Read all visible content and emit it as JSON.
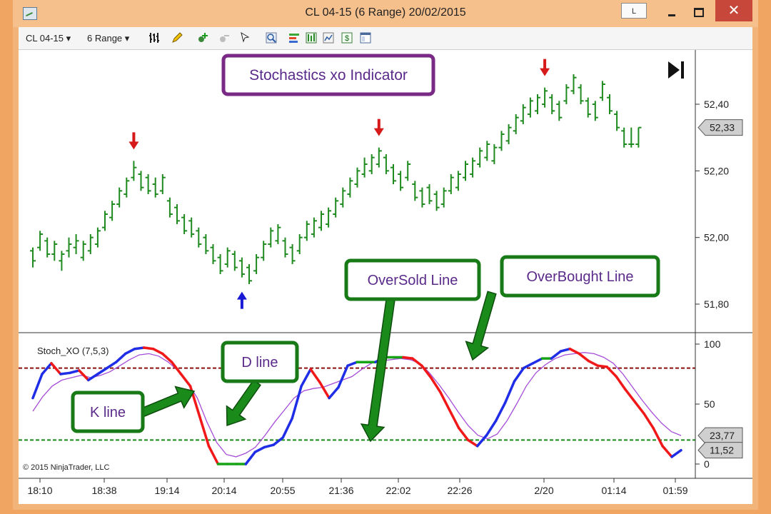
{
  "window": {
    "title": "CL 04-15 (6 Range)  20/02/2015",
    "l_button": "L",
    "close_glyph": "✕"
  },
  "toolbar": {
    "instrument": "CL 04-15",
    "interval": "6 Range",
    "icons": [
      "bar-style-icon",
      "pencil-icon",
      "add-indicator-icon",
      "remove-indicator-icon",
      "cursor-icon",
      "zoom-icon",
      "strategy-icon",
      "data-box-icon",
      "chart-icon",
      "dollar-icon",
      "properties-icon"
    ]
  },
  "colors": {
    "bars": "#1f8a1f",
    "k_up": "#1f2ee6",
    "k_down": "#f01818",
    "k_flat": "#17a317",
    "d_line": "#a64dd8",
    "overbought": "#8b1010",
    "oversold": "#178a17",
    "annotation_purple": "#7a2a86",
    "annotation_green": "#177a17"
  },
  "annotations": {
    "title": "Stochastics xo Indicator",
    "k_line": "K line",
    "d_line": "D line",
    "oversold": "OverSold Line",
    "overbought": "OverBought Line"
  },
  "chart_data": [
    {
      "type": "range-bar",
      "title": "CL 04-15 (6 Range)",
      "ylim": [
        51.74,
        52.52
      ],
      "y_ticks": [
        "52,40",
        "52,20",
        "52,00",
        "51,80"
      ],
      "y_tick_values": [
        52.4,
        52.2,
        52.0,
        51.8
      ],
      "last_price_label": "52,33",
      "last_price": 52.33,
      "bars": [
        [
          51.91,
          51.97,
          51.96,
          51.93
        ],
        [
          51.96,
          52.02,
          51.97,
          52.01
        ],
        [
          51.94,
          52.0,
          51.99,
          51.95
        ],
        [
          51.93,
          51.99,
          51.95,
          51.98
        ],
        [
          51.9,
          51.96,
          51.93,
          51.95
        ],
        [
          51.94,
          52.0,
          51.96,
          51.98
        ],
        [
          51.95,
          52.01,
          51.97,
          51.99
        ],
        [
          51.93,
          51.99,
          51.94,
          51.98
        ],
        [
          51.95,
          52.01,
          51.96,
          52.0
        ],
        [
          51.97,
          52.03,
          51.98,
          52.02
        ],
        [
          52.02,
          52.08,
          52.03,
          52.07
        ],
        [
          52.05,
          52.11,
          52.06,
          52.1
        ],
        [
          52.09,
          52.15,
          52.1,
          52.14
        ],
        [
          52.12,
          52.18,
          52.13,
          52.17
        ],
        [
          52.17,
          52.23,
          52.18,
          52.21
        ],
        [
          52.14,
          52.2,
          52.19,
          52.15
        ],
        [
          52.13,
          52.19,
          52.18,
          52.14
        ],
        [
          52.12,
          52.18,
          52.16,
          52.13
        ],
        [
          52.13,
          52.19,
          52.14,
          52.18
        ],
        [
          52.06,
          52.12,
          52.11,
          52.07
        ],
        [
          52.04,
          52.1,
          52.09,
          52.05
        ],
        [
          52.01,
          52.07,
          52.06,
          52.02
        ],
        [
          52.0,
          52.06,
          52.05,
          52.01
        ],
        [
          51.97,
          52.03,
          52.02,
          51.98
        ],
        [
          51.95,
          52.01,
          52.0,
          51.96
        ],
        [
          51.92,
          51.98,
          51.97,
          51.93
        ],
        [
          51.89,
          51.95,
          51.94,
          51.9
        ],
        [
          51.91,
          51.97,
          51.92,
          51.96
        ],
        [
          51.9,
          51.96,
          51.95,
          51.91
        ],
        [
          51.88,
          51.94,
          51.93,
          51.89
        ],
        [
          51.86,
          51.92,
          51.91,
          51.87
        ],
        [
          51.89,
          51.95,
          51.9,
          51.94
        ],
        [
          51.93,
          51.99,
          51.94,
          51.98
        ],
        [
          51.97,
          52.03,
          51.98,
          52.02
        ],
        [
          51.98,
          52.04,
          51.99,
          52.03
        ],
        [
          51.94,
          52.0,
          51.99,
          51.95
        ],
        [
          51.92,
          51.98,
          51.97,
          51.93
        ],
        [
          51.95,
          52.01,
          51.96,
          52.0
        ],
        [
          51.99,
          52.05,
          52.0,
          52.04
        ],
        [
          52.0,
          52.06,
          52.01,
          52.05
        ],
        [
          52.02,
          52.08,
          52.03,
          52.07
        ],
        [
          52.03,
          52.09,
          52.04,
          52.08
        ],
        [
          52.06,
          52.12,
          52.07,
          52.11
        ],
        [
          52.09,
          52.15,
          52.1,
          52.14
        ],
        [
          52.12,
          52.18,
          52.13,
          52.17
        ],
        [
          52.15,
          52.21,
          52.16,
          52.2
        ],
        [
          52.18,
          52.24,
          52.19,
          52.22
        ],
        [
          52.19,
          52.25,
          52.2,
          52.24
        ],
        [
          52.21,
          52.27,
          52.22,
          52.26
        ],
        [
          52.19,
          52.25,
          52.24,
          52.2
        ],
        [
          52.16,
          52.22,
          52.21,
          52.17
        ],
        [
          52.14,
          52.2,
          52.19,
          52.15
        ],
        [
          52.17,
          52.23,
          52.18,
          52.22
        ],
        [
          52.11,
          52.17,
          52.16,
          52.12
        ],
        [
          52.09,
          52.15,
          52.14,
          52.1
        ],
        [
          52.1,
          52.16,
          52.15,
          52.11
        ],
        [
          52.08,
          52.14,
          52.13,
          52.09
        ],
        [
          52.09,
          52.15,
          52.1,
          52.14
        ],
        [
          52.13,
          52.19,
          52.14,
          52.18
        ],
        [
          52.14,
          52.2,
          52.15,
          52.19
        ],
        [
          52.17,
          52.23,
          52.18,
          52.22
        ],
        [
          52.18,
          52.24,
          52.19,
          52.23
        ],
        [
          52.21,
          52.27,
          52.22,
          52.26
        ],
        [
          52.23,
          52.29,
          52.24,
          52.28
        ],
        [
          52.22,
          52.28,
          52.23,
          52.27
        ],
        [
          52.26,
          52.32,
          52.27,
          52.31
        ],
        [
          52.28,
          52.34,
          52.29,
          52.33
        ],
        [
          52.31,
          52.37,
          52.32,
          52.36
        ],
        [
          52.34,
          52.4,
          52.35,
          52.39
        ],
        [
          52.36,
          52.42,
          52.37,
          52.41
        ],
        [
          52.37,
          52.43,
          52.38,
          52.42
        ],
        [
          52.39,
          52.45,
          52.4,
          52.44
        ],
        [
          52.37,
          52.43,
          52.42,
          52.38
        ],
        [
          52.35,
          52.41,
          52.4,
          52.36
        ],
        [
          52.4,
          52.46,
          52.41,
          52.45
        ],
        [
          52.43,
          52.49,
          52.44,
          52.48
        ],
        [
          52.4,
          52.46,
          52.45,
          52.41
        ],
        [
          52.36,
          52.42,
          52.41,
          52.37
        ],
        [
          52.35,
          52.41,
          52.4,
          52.36
        ],
        [
          52.41,
          52.47,
          52.42,
          52.46
        ],
        [
          52.37,
          52.43,
          52.42,
          52.38
        ],
        [
          52.32,
          52.38,
          52.37,
          52.33
        ],
        [
          52.27,
          52.33,
          52.32,
          52.28
        ],
        [
          52.27,
          52.33,
          52.28,
          52.28
        ],
        [
          52.27,
          52.33,
          52.28,
          52.33
        ]
      ],
      "bar_format": "[low, high, open, close]",
      "signals": [
        {
          "bar": 14,
          "dir": "down"
        },
        {
          "bar": 29,
          "dir": "up"
        },
        {
          "bar": 48,
          "dir": "down"
        },
        {
          "bar": 71,
          "dir": "down"
        }
      ]
    },
    {
      "type": "line",
      "title": "Stoch_XO (7,5,3)",
      "ylim": [
        0,
        100
      ],
      "y_ticks": [
        "100",
        "50",
        "0"
      ],
      "y_tick_values": [
        100,
        50,
        0
      ],
      "overbought": 80,
      "oversold": 20,
      "k_label": "11,52",
      "d_label": "23,77",
      "k_last": 11.52,
      "d_last": 23.77,
      "series": [
        {
          "label": "K",
          "values": [
            55,
            75,
            84,
            75,
            76,
            78,
            70,
            75,
            80,
            85,
            92,
            96,
            97,
            96,
            92,
            85,
            75,
            65,
            40,
            15,
            0,
            0,
            0,
            0,
            10,
            14,
            16,
            22,
            38,
            65,
            79,
            68,
            55,
            64,
            82,
            85,
            85,
            85,
            89,
            89,
            89,
            88,
            82,
            72,
            60,
            45,
            30,
            20,
            15,
            24,
            36,
            51,
            69,
            80,
            84,
            88,
            88,
            94,
            96,
            92,
            86,
            82,
            81,
            73,
            62,
            52,
            42,
            30,
            15,
            6,
            11.52
          ]
        },
        {
          "label": "D",
          "values": [
            44,
            56,
            65,
            70,
            72,
            74,
            72,
            74,
            77,
            82,
            87,
            91,
            92,
            90,
            85,
            78,
            68,
            55,
            35,
            18,
            8,
            6,
            9,
            14,
            24,
            35,
            45,
            55,
            61,
            63,
            64,
            67,
            70,
            73,
            79,
            84,
            86,
            87,
            88,
            87,
            84,
            76,
            66,
            55,
            43,
            32,
            24,
            21,
            25,
            36,
            50,
            65,
            76,
            83,
            88,
            91,
            92,
            93,
            92,
            89,
            84,
            75,
            64,
            53,
            43,
            34,
            27,
            23.77
          ]
        }
      ]
    }
  ],
  "x_axis": {
    "labels": [
      "18:10",
      "18:38",
      "19:14",
      "20:14",
      "20:55",
      "21:36",
      "22:02",
      "22:26",
      "2/20",
      "01:14",
      "01:59"
    ]
  },
  "copyright": "© 2015 NinjaTrader, LLC"
}
